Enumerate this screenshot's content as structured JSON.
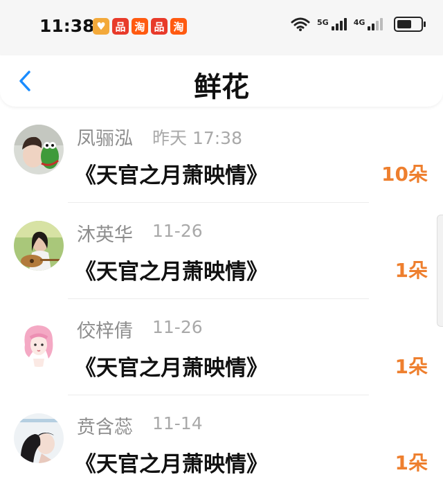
{
  "status_bar": {
    "time": "11:38",
    "apps": [
      {
        "icon": "heart-app-icon",
        "glyph": "♥",
        "color": "#f3a93a"
      },
      {
        "icon": "pinduoduo-app-icon",
        "glyph": "品",
        "color": "#e83a2a"
      },
      {
        "icon": "taobao-app-icon",
        "glyph": "淘",
        "color": "#ff5a10"
      },
      {
        "icon": "pinduoduo-app-icon",
        "glyph": "品",
        "color": "#e83a2a"
      },
      {
        "icon": "taobao-app-icon",
        "glyph": "淘",
        "color": "#ff5a10"
      }
    ],
    "signal_5g": "5G",
    "signal_4g": "4G",
    "battery_level": 0.7
  },
  "header": {
    "title": "鲜花",
    "back_icon": "chevron-left-icon"
  },
  "accent_color": "#ee7f2e",
  "records": [
    {
      "name": "凤骊泓",
      "date": "昨天 17:38",
      "book": "《天官之月萧映情》",
      "count": "10朵"
    },
    {
      "name": "沐英华",
      "date": "11-26",
      "book": "《天官之月萧映情》",
      "count": "1朵"
    },
    {
      "name": "佼梓倩",
      "date": "11-26",
      "book": "《天官之月萧映情》",
      "count": "1朵"
    },
    {
      "name": "贲含蕊",
      "date": "11-14",
      "book": "《天官之月萧映情》",
      "count": "1朵"
    }
  ]
}
